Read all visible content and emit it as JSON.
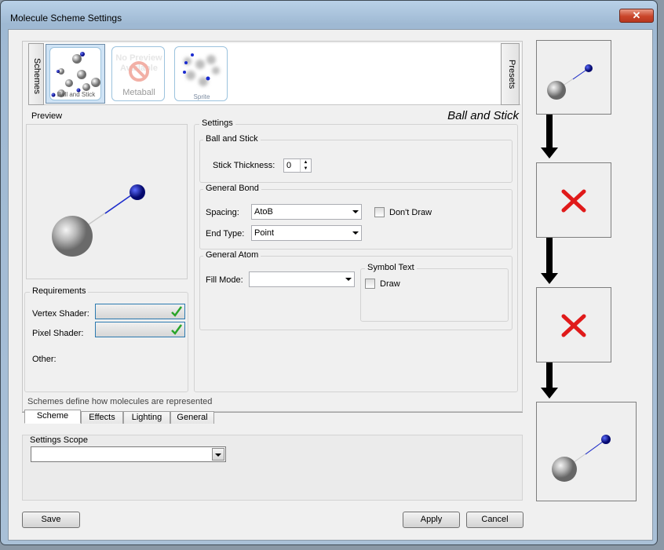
{
  "window": {
    "title": "Molecule Scheme Settings",
    "close_label": "✕"
  },
  "side_tabs": {
    "left": "Schemes",
    "right": "Presets"
  },
  "scheme_thumbs": [
    {
      "caption": "Ball and Stick"
    },
    {
      "caption": "Metaball",
      "overlay": "No Preview Available"
    },
    {
      "caption": "Sprite"
    }
  ],
  "scheme_title": "Ball and Stick",
  "preview": {
    "label": "Preview"
  },
  "requirements": {
    "label": "Requirements",
    "vertex_label": "Vertex Shader:",
    "pixel_label": "Pixel Shader:",
    "other_label": "Other:"
  },
  "settings": {
    "label": "Settings",
    "ball_and_stick": {
      "label": "Ball and Stick",
      "stick_thickness_label": "Stick Thickness:",
      "stick_thickness_value": "0"
    },
    "general_bond": {
      "label": "General Bond",
      "spacing_label": "Spacing:",
      "spacing_value": "AtoB",
      "dont_draw_label": "Don't Draw",
      "end_type_label": "End Type:",
      "end_type_value": "Point"
    },
    "general_atom": {
      "label": "General Atom",
      "fill_mode_label": "Fill Mode:",
      "fill_mode_value": "",
      "symbol_text_label": "Symbol Text",
      "draw_label": "Draw"
    }
  },
  "status_text": "Schemes define how molecules are represented",
  "bottom_tabs": [
    "Scheme",
    "Effects",
    "Lighting",
    "General"
  ],
  "settings_scope": {
    "label": "Settings Scope",
    "value": ""
  },
  "buttons": {
    "save": "Save",
    "apply": "Apply",
    "cancel": "Cancel"
  },
  "colors": {
    "atom_blue": "#0a14c8",
    "bond_blue": "#1a2ad0",
    "cross_red": "#e01a1a",
    "check_green": "#2aa52a"
  }
}
